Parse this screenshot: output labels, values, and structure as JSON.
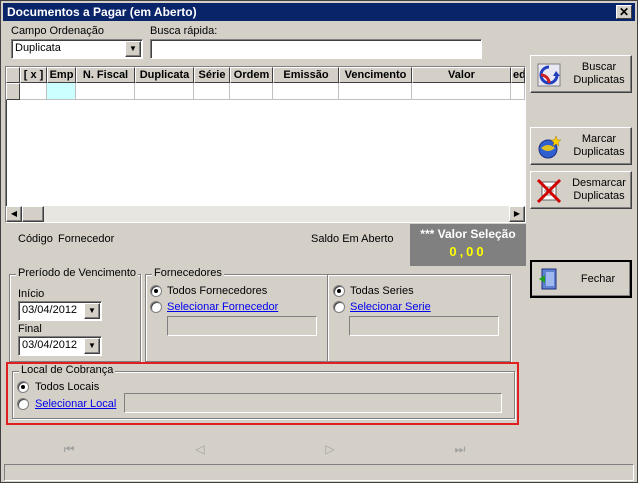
{
  "window": {
    "title": "Documentos a Pagar (em Aberto)",
    "close_label": "✕"
  },
  "sort": {
    "label": "Campo Ordenação",
    "value": "Duplicata"
  },
  "search": {
    "label": "Busca rápida:",
    "value": ""
  },
  "grid": {
    "columns": [
      "[ x ]",
      "Emp",
      "N. Fiscal",
      "Duplicata",
      "Série",
      "Ordem",
      "Emissão",
      "Vencimento",
      "Valor",
      "ed"
    ]
  },
  "summary": {
    "codigo_label": "Código",
    "fornecedor_label": "Fornecedor",
    "saldo_label": "Saldo Em Aberto",
    "valor_selecao_label": "*** Valor Seleção",
    "valor_selecao_value": "0,00",
    "valor_colors": {
      "bg": "#808080",
      "label": "#ffffff",
      "value": "#ffff00"
    }
  },
  "periodo": {
    "title": "Preríodo de Vencimento",
    "inicio_label": "Início",
    "inicio_value": "03/04/2012",
    "final_label": "Final",
    "final_value": "03/04/2012"
  },
  "fornecedores": {
    "title": "Fornecedores",
    "todos_label": "Todos Fornecedores",
    "selecionar_label": "Selecionar Fornecedor",
    "todas_series_label": "Todas Series",
    "selecionar_serie_label": "Selecionar Serie"
  },
  "cobranca": {
    "title": "Local de Cobrança",
    "todos_label": "Todos Locais",
    "selecionar_label": "Selecionar Local",
    "highlight_color": "#e02020"
  },
  "buttons": {
    "buscar": "Buscar Duplicatas",
    "marcar": "Marcar Duplicatas",
    "desmarcar": "Desmarcar Duplicatas",
    "fechar": "Fechar"
  },
  "navigator": {
    "first": "⏮",
    "prior": "◁",
    "next": "▷",
    "last": "⏭"
  }
}
